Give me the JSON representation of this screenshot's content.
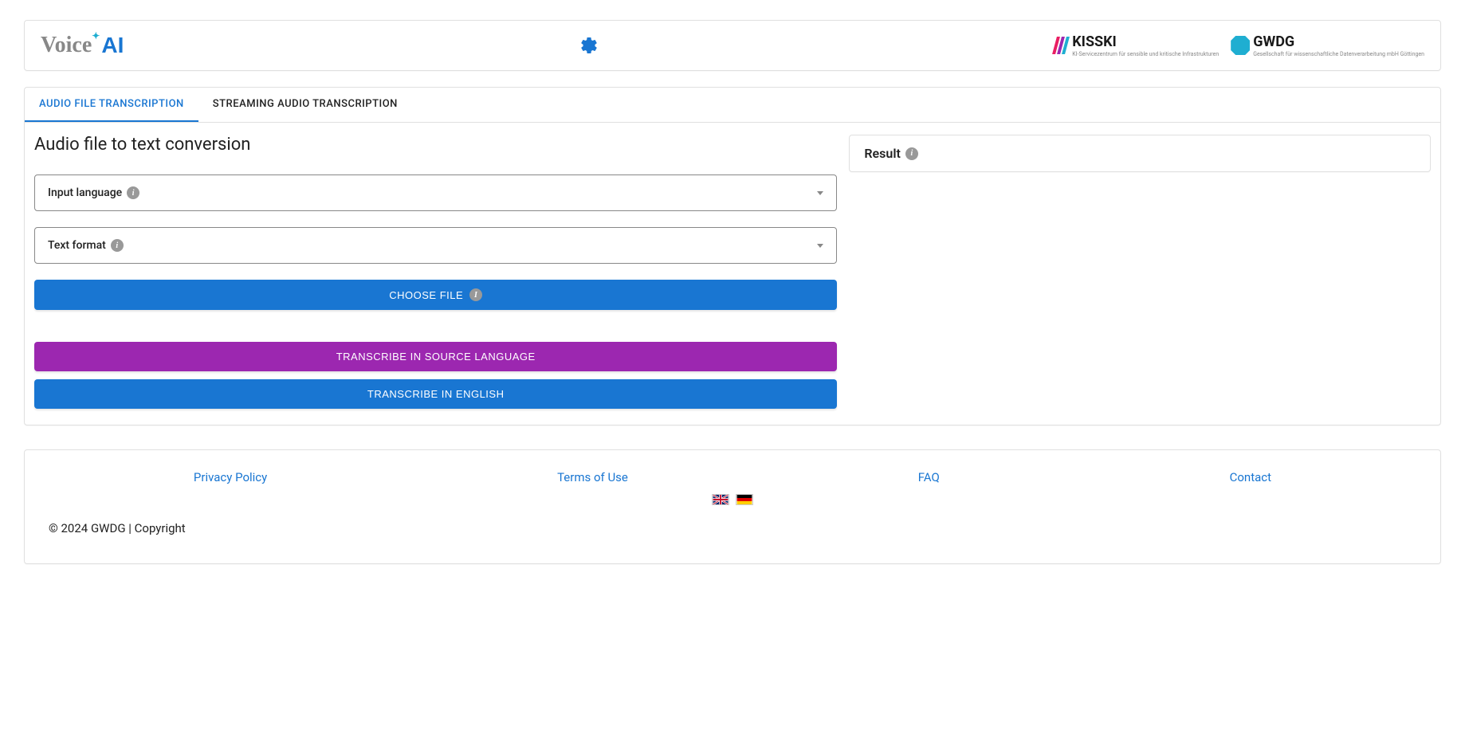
{
  "header": {
    "logo_text_1": "Voice",
    "logo_text_2": "AI",
    "kisski_label": "KISSKI",
    "kisski_subtext": "KI-Servicezentrum für sensible\nund kritische Infrastrukturen",
    "gwdg_label": "GWDG",
    "gwdg_subtext": "Gesellschaft für wissenschaftliche\nDatenverarbeitung mbH Göttingen"
  },
  "tabs": {
    "tab1": "AUDIO FILE TRANSCRIPTION",
    "tab2": "STREAMING AUDIO TRANSCRIPTION"
  },
  "main": {
    "title": "Audio file to text conversion",
    "input_language_label": "Input language",
    "text_format_label": "Text format",
    "choose_file_label": "CHOOSE FILE",
    "transcribe_source_label": "TRANSCRIBE IN SOURCE LANGUAGE",
    "transcribe_english_label": "TRANSCRIBE IN ENGLISH"
  },
  "result": {
    "title": "Result"
  },
  "footer": {
    "privacy": "Privacy Policy",
    "terms": "Terms of Use",
    "faq": "FAQ",
    "contact": "Contact",
    "copyright": "© 2024 GWDG | Copyright"
  }
}
